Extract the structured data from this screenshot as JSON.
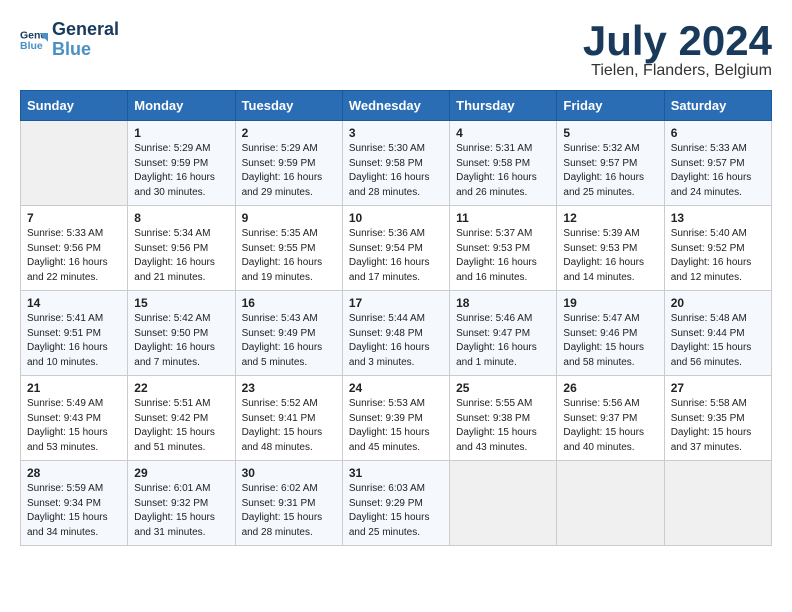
{
  "logo": {
    "line1": "General",
    "line2": "Blue"
  },
  "title": "July 2024",
  "subtitle": "Tielen, Flanders, Belgium",
  "days_header": [
    "Sunday",
    "Monday",
    "Tuesday",
    "Wednesday",
    "Thursday",
    "Friday",
    "Saturday"
  ],
  "weeks": [
    [
      {
        "day": "",
        "info": ""
      },
      {
        "day": "1",
        "info": "Sunrise: 5:29 AM\nSunset: 9:59 PM\nDaylight: 16 hours\nand 30 minutes."
      },
      {
        "day": "2",
        "info": "Sunrise: 5:29 AM\nSunset: 9:59 PM\nDaylight: 16 hours\nand 29 minutes."
      },
      {
        "day": "3",
        "info": "Sunrise: 5:30 AM\nSunset: 9:58 PM\nDaylight: 16 hours\nand 28 minutes."
      },
      {
        "day": "4",
        "info": "Sunrise: 5:31 AM\nSunset: 9:58 PM\nDaylight: 16 hours\nand 26 minutes."
      },
      {
        "day": "5",
        "info": "Sunrise: 5:32 AM\nSunset: 9:57 PM\nDaylight: 16 hours\nand 25 minutes."
      },
      {
        "day": "6",
        "info": "Sunrise: 5:33 AM\nSunset: 9:57 PM\nDaylight: 16 hours\nand 24 minutes."
      }
    ],
    [
      {
        "day": "7",
        "info": "Sunrise: 5:33 AM\nSunset: 9:56 PM\nDaylight: 16 hours\nand 22 minutes."
      },
      {
        "day": "8",
        "info": "Sunrise: 5:34 AM\nSunset: 9:56 PM\nDaylight: 16 hours\nand 21 minutes."
      },
      {
        "day": "9",
        "info": "Sunrise: 5:35 AM\nSunset: 9:55 PM\nDaylight: 16 hours\nand 19 minutes."
      },
      {
        "day": "10",
        "info": "Sunrise: 5:36 AM\nSunset: 9:54 PM\nDaylight: 16 hours\nand 17 minutes."
      },
      {
        "day": "11",
        "info": "Sunrise: 5:37 AM\nSunset: 9:53 PM\nDaylight: 16 hours\nand 16 minutes."
      },
      {
        "day": "12",
        "info": "Sunrise: 5:39 AM\nSunset: 9:53 PM\nDaylight: 16 hours\nand 14 minutes."
      },
      {
        "day": "13",
        "info": "Sunrise: 5:40 AM\nSunset: 9:52 PM\nDaylight: 16 hours\nand 12 minutes."
      }
    ],
    [
      {
        "day": "14",
        "info": "Sunrise: 5:41 AM\nSunset: 9:51 PM\nDaylight: 16 hours\nand 10 minutes."
      },
      {
        "day": "15",
        "info": "Sunrise: 5:42 AM\nSunset: 9:50 PM\nDaylight: 16 hours\nand 7 minutes."
      },
      {
        "day": "16",
        "info": "Sunrise: 5:43 AM\nSunset: 9:49 PM\nDaylight: 16 hours\nand 5 minutes."
      },
      {
        "day": "17",
        "info": "Sunrise: 5:44 AM\nSunset: 9:48 PM\nDaylight: 16 hours\nand 3 minutes."
      },
      {
        "day": "18",
        "info": "Sunrise: 5:46 AM\nSunset: 9:47 PM\nDaylight: 16 hours\nand 1 minute."
      },
      {
        "day": "19",
        "info": "Sunrise: 5:47 AM\nSunset: 9:46 PM\nDaylight: 15 hours\nand 58 minutes."
      },
      {
        "day": "20",
        "info": "Sunrise: 5:48 AM\nSunset: 9:44 PM\nDaylight: 15 hours\nand 56 minutes."
      }
    ],
    [
      {
        "day": "21",
        "info": "Sunrise: 5:49 AM\nSunset: 9:43 PM\nDaylight: 15 hours\nand 53 minutes."
      },
      {
        "day": "22",
        "info": "Sunrise: 5:51 AM\nSunset: 9:42 PM\nDaylight: 15 hours\nand 51 minutes."
      },
      {
        "day": "23",
        "info": "Sunrise: 5:52 AM\nSunset: 9:41 PM\nDaylight: 15 hours\nand 48 minutes."
      },
      {
        "day": "24",
        "info": "Sunrise: 5:53 AM\nSunset: 9:39 PM\nDaylight: 15 hours\nand 45 minutes."
      },
      {
        "day": "25",
        "info": "Sunrise: 5:55 AM\nSunset: 9:38 PM\nDaylight: 15 hours\nand 43 minutes."
      },
      {
        "day": "26",
        "info": "Sunrise: 5:56 AM\nSunset: 9:37 PM\nDaylight: 15 hours\nand 40 minutes."
      },
      {
        "day": "27",
        "info": "Sunrise: 5:58 AM\nSunset: 9:35 PM\nDaylight: 15 hours\nand 37 minutes."
      }
    ],
    [
      {
        "day": "28",
        "info": "Sunrise: 5:59 AM\nSunset: 9:34 PM\nDaylight: 15 hours\nand 34 minutes."
      },
      {
        "day": "29",
        "info": "Sunrise: 6:01 AM\nSunset: 9:32 PM\nDaylight: 15 hours\nand 31 minutes."
      },
      {
        "day": "30",
        "info": "Sunrise: 6:02 AM\nSunset: 9:31 PM\nDaylight: 15 hours\nand 28 minutes."
      },
      {
        "day": "31",
        "info": "Sunrise: 6:03 AM\nSunset: 9:29 PM\nDaylight: 15 hours\nand 25 minutes."
      },
      {
        "day": "",
        "info": ""
      },
      {
        "day": "",
        "info": ""
      },
      {
        "day": "",
        "info": ""
      }
    ]
  ]
}
